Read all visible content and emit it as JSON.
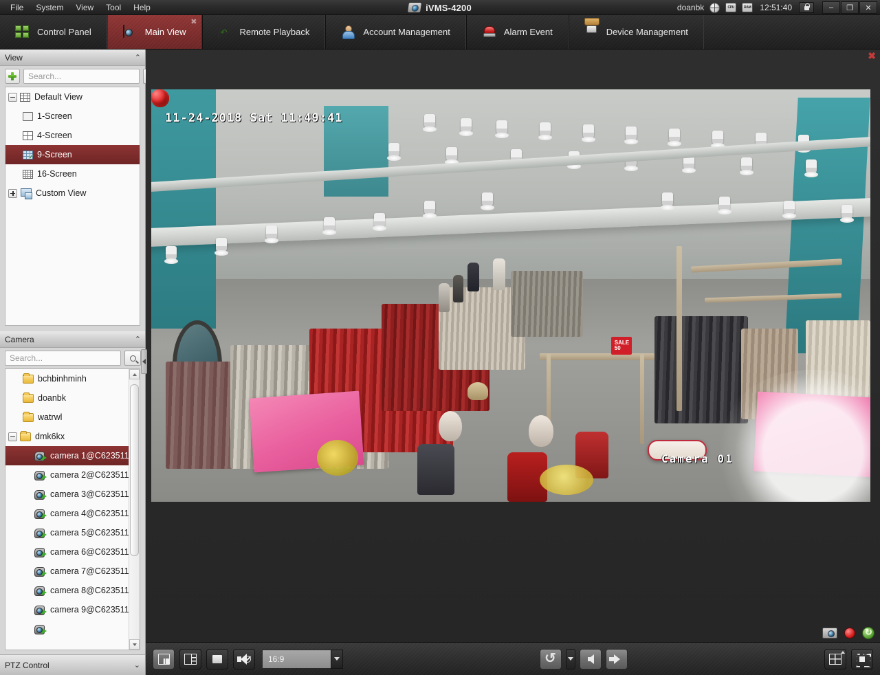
{
  "window": {
    "app_title": "iVMS-4200",
    "menus": [
      "File",
      "System",
      "View",
      "Tool",
      "Help"
    ],
    "user": "doanbk",
    "time": "12:51:40",
    "status_icons": [
      "globe-icon",
      "cpu-icon",
      "ram-icon",
      "lock-icon"
    ],
    "cpu_label": "CPU",
    "ram_label": "RAM",
    "controls": {
      "minimize": "–",
      "restore": "❐",
      "close": "✕"
    }
  },
  "tabs": [
    {
      "label": "Control Panel",
      "icon": "control-panel-icon",
      "active": false
    },
    {
      "label": "Main View",
      "icon": "main-view-icon",
      "active": true,
      "closable": true
    },
    {
      "label": "Remote Playback",
      "icon": "remote-playback-icon",
      "active": false
    },
    {
      "label": "Account Management",
      "icon": "account-management-icon",
      "active": false
    },
    {
      "label": "Alarm Event",
      "icon": "alarm-event-icon",
      "active": false
    },
    {
      "label": "Device Management",
      "icon": "device-management-icon",
      "active": false
    }
  ],
  "view_panel": {
    "title": "View",
    "collapse_chevron": "⌃",
    "add_button": "add-view-button",
    "search_placeholder": "Search...",
    "search_value": "",
    "tree": [
      {
        "label": "Default View",
        "icon": "grid-view-icon",
        "level": 0,
        "expander": "minus",
        "selected": false
      },
      {
        "label": "1-Screen",
        "icon": "screen-1-icon",
        "level": 1,
        "expander": "none",
        "selected": false
      },
      {
        "label": "4-Screen",
        "icon": "screen-4-icon",
        "level": 1,
        "expander": "none",
        "selected": false
      },
      {
        "label": "9-Screen",
        "icon": "screen-9-icon",
        "level": 1,
        "expander": "none",
        "selected": true
      },
      {
        "label": "16-Screen",
        "icon": "screen-16-icon",
        "level": 1,
        "expander": "none",
        "selected": false
      },
      {
        "label": "Custom View",
        "icon": "custom-view-icon",
        "level": 0,
        "expander": "plus",
        "selected": false
      }
    ]
  },
  "camera_panel": {
    "title": "Camera",
    "collapse_chevron": "⌃",
    "search_placeholder": "Search...",
    "search_value": "",
    "tree": [
      {
        "label": "bchbinhminh",
        "icon": "folder-icon",
        "level": 0,
        "expander": "none",
        "selected": false
      },
      {
        "label": "doanbk",
        "icon": "folder-icon",
        "level": 0,
        "expander": "none",
        "selected": false
      },
      {
        "label": "watrwl",
        "icon": "folder-icon",
        "level": 0,
        "expander": "none",
        "selected": false
      },
      {
        "label": "dmk6kx",
        "icon": "folder-icon",
        "level": 0,
        "expander": "minus",
        "selected": false
      },
      {
        "label": "camera 1@C623511...",
        "icon": "camera-icon",
        "level": 1,
        "expander": "none",
        "selected": true
      },
      {
        "label": "camera 2@C623511...",
        "icon": "camera-icon",
        "level": 1,
        "expander": "none",
        "selected": false
      },
      {
        "label": "camera 3@C623511...",
        "icon": "camera-icon",
        "level": 1,
        "expander": "none",
        "selected": false
      },
      {
        "label": "camera 4@C623511...",
        "icon": "camera-icon",
        "level": 1,
        "expander": "none",
        "selected": false
      },
      {
        "label": "camera 5@C623511...",
        "icon": "camera-icon",
        "level": 1,
        "expander": "none",
        "selected": false
      },
      {
        "label": "camera 6@C623511...",
        "icon": "camera-icon",
        "level": 1,
        "expander": "none",
        "selected": false
      },
      {
        "label": "camera 7@C623511...",
        "icon": "camera-icon",
        "level": 1,
        "expander": "none",
        "selected": false
      },
      {
        "label": "camera 8@C623511...",
        "icon": "camera-icon",
        "level": 1,
        "expander": "none",
        "selected": false
      },
      {
        "label": "camera 9@C623511...",
        "icon": "camera-icon",
        "level": 1,
        "expander": "none",
        "selected": false
      }
    ]
  },
  "ptz_panel": {
    "title": "PTZ Control",
    "collapse_chevron": "⌄"
  },
  "video": {
    "close_label": "✖",
    "osd_timestamp": "11-24-2018 Sat 11:49:41",
    "osd_camera_name": "Camera 01",
    "status_icons": [
      "snapshot-icon",
      "recording-icon",
      "stream-refresh-icon"
    ]
  },
  "bottom_toolbar": {
    "left_buttons": [
      {
        "name": "save-layout-button",
        "icon": "save-layout-icon"
      },
      {
        "name": "custom-layout-button",
        "icon": "layout-icon"
      },
      {
        "name": "stop-all-live-view-button",
        "icon": "stop-icon"
      },
      {
        "name": "mute-button",
        "icon": "mute-icon"
      }
    ],
    "aspect_ratio": {
      "value": "16:9",
      "caret": "▼"
    },
    "center_buttons": [
      {
        "name": "auto-switch-button",
        "icon": "rotate-icon"
      },
      {
        "name": "auto-switch-dropdown",
        "icon": "caret-down-icon"
      },
      {
        "name": "previous-page-button",
        "icon": "arrow-left-icon"
      },
      {
        "name": "next-page-button",
        "icon": "arrow-right-icon"
      }
    ],
    "right_buttons": [
      {
        "name": "window-division-button",
        "icon": "grid-icon"
      },
      {
        "name": "full-screen-button",
        "icon": "fullscreen-icon"
      }
    ]
  },
  "colors": {
    "accent_red": "#7c2b2b",
    "tab_active": "#7e2c2c",
    "panel_bg": "#d6d6d6",
    "dark_chrome": "#2b2b2b",
    "record_red": "#d51b1b"
  }
}
